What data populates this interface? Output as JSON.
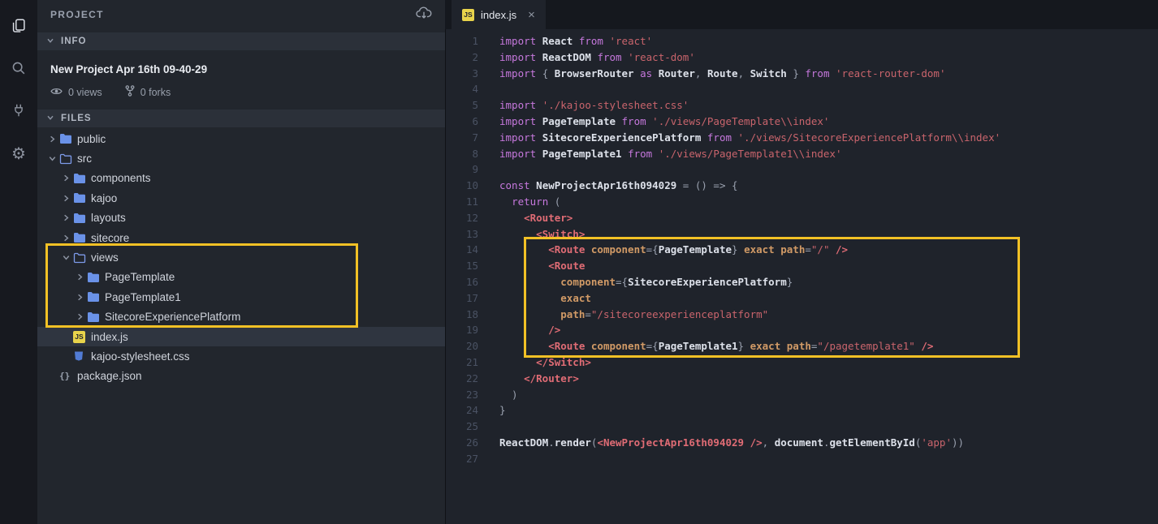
{
  "activity_bar": {
    "icons": [
      "files-icon",
      "search-icon",
      "plug-icon",
      "settings-icon"
    ]
  },
  "icons": {
    "js_badge": "JS",
    "json_badge": "{}",
    "close": "×",
    "settings": "⚙"
  },
  "sidebar": {
    "header": {
      "title": "PROJECT"
    },
    "info": {
      "label": "INFO",
      "project_name": "New Project Apr 16th 09-40-29",
      "views": "0 views",
      "forks": "0 forks"
    },
    "files": {
      "label": "FILES",
      "tree": [
        {
          "label": "public",
          "type": "folder",
          "state": "closed",
          "depth": 0
        },
        {
          "label": "src",
          "type": "folder",
          "state": "open",
          "depth": 0
        },
        {
          "label": "components",
          "type": "folder",
          "state": "closed",
          "depth": 1
        },
        {
          "label": "kajoo",
          "type": "folder",
          "state": "closed",
          "depth": 1
        },
        {
          "label": "layouts",
          "type": "folder",
          "state": "closed",
          "depth": 1
        },
        {
          "label": "sitecore",
          "type": "folder",
          "state": "closed",
          "depth": 1
        },
        {
          "label": "views",
          "type": "folder",
          "state": "open",
          "depth": 1
        },
        {
          "label": "PageTemplate",
          "type": "folder",
          "state": "closed",
          "depth": 2
        },
        {
          "label": "PageTemplate1",
          "type": "folder",
          "state": "closed",
          "depth": 2
        },
        {
          "label": "SitecoreExperiencePlatform",
          "type": "folder",
          "state": "closed",
          "depth": 2
        },
        {
          "label": "index.js",
          "type": "file",
          "icon": "js",
          "depth": 1,
          "selected": true
        },
        {
          "label": "kajoo-stylesheet.css",
          "type": "file",
          "icon": "css",
          "depth": 1
        },
        {
          "label": "package.json",
          "type": "file",
          "icon": "json",
          "depth": 0
        }
      ]
    }
  },
  "editor": {
    "tab": {
      "label": "index.js",
      "close_glyph": "×"
    },
    "code": {
      "palette": {
        "kw": "#c678dd",
        "id": "#dde1ea",
        "fn": "#dde1ea",
        "str": "#c9646c",
        "tag": "#e06c75",
        "attr": "#d19a66",
        "pun": "#9aa1af",
        "pl": "#abb2bf"
      },
      "lines": [
        [
          [
            "kw",
            "import"
          ],
          [
            "pl",
            " "
          ],
          [
            "id",
            "React"
          ],
          [
            "pl",
            " "
          ],
          [
            "kw",
            "from"
          ],
          [
            "pl",
            " "
          ],
          [
            "str",
            "'react'"
          ]
        ],
        [
          [
            "kw",
            "import"
          ],
          [
            "pl",
            " "
          ],
          [
            "id",
            "ReactDOM"
          ],
          [
            "pl",
            " "
          ],
          [
            "kw",
            "from"
          ],
          [
            "pl",
            " "
          ],
          [
            "str",
            "'react-dom'"
          ]
        ],
        [
          [
            "kw",
            "import"
          ],
          [
            "pl",
            " "
          ],
          [
            "pun",
            "{ "
          ],
          [
            "id",
            "BrowserRouter"
          ],
          [
            "pl",
            " "
          ],
          [
            "kw",
            "as"
          ],
          [
            "pl",
            " "
          ],
          [
            "id",
            "Router"
          ],
          [
            "pun",
            ", "
          ],
          [
            "id",
            "Route"
          ],
          [
            "pun",
            ", "
          ],
          [
            "id",
            "Switch"
          ],
          [
            "pun",
            " } "
          ],
          [
            "kw",
            "from"
          ],
          [
            "pl",
            " "
          ],
          [
            "str",
            "'react-router-dom'"
          ]
        ],
        [],
        [
          [
            "kw",
            "import"
          ],
          [
            "pl",
            " "
          ],
          [
            "str",
            "'./kajoo-stylesheet.css'"
          ]
        ],
        [
          [
            "kw",
            "import"
          ],
          [
            "pl",
            " "
          ],
          [
            "id",
            "PageTemplate"
          ],
          [
            "pl",
            " "
          ],
          [
            "kw",
            "from"
          ],
          [
            "pl",
            " "
          ],
          [
            "str",
            "'./views/PageTemplate\\\\index'"
          ]
        ],
        [
          [
            "kw",
            "import"
          ],
          [
            "pl",
            " "
          ],
          [
            "id",
            "SitecoreExperiencePlatform"
          ],
          [
            "pl",
            " "
          ],
          [
            "kw",
            "from"
          ],
          [
            "pl",
            " "
          ],
          [
            "str",
            "'./views/SitecoreExperiencePlatform\\\\index'"
          ]
        ],
        [
          [
            "kw",
            "import"
          ],
          [
            "pl",
            " "
          ],
          [
            "id",
            "PageTemplate1"
          ],
          [
            "pl",
            " "
          ],
          [
            "kw",
            "from"
          ],
          [
            "pl",
            " "
          ],
          [
            "str",
            "'./views/PageTemplate1\\\\index'"
          ]
        ],
        [],
        [
          [
            "kw",
            "const"
          ],
          [
            "pl",
            " "
          ],
          [
            "fn",
            "NewProjectApr16th094029"
          ],
          [
            "pun",
            " = () => {"
          ]
        ],
        [
          [
            "pl",
            "  "
          ],
          [
            "kw",
            "return"
          ],
          [
            "pun",
            " ("
          ]
        ],
        [
          [
            "pl",
            "    "
          ],
          [
            "tag",
            "<Router>"
          ]
        ],
        [
          [
            "pl",
            "      "
          ],
          [
            "tag",
            "<Switch>"
          ]
        ],
        [
          [
            "pl",
            "        "
          ],
          [
            "tag",
            "<Route"
          ],
          [
            "pl",
            " "
          ],
          [
            "attr",
            "component"
          ],
          [
            "pun",
            "={"
          ],
          [
            "id",
            "PageTemplate"
          ],
          [
            "pun",
            "}"
          ],
          [
            "pl",
            " "
          ],
          [
            "attr",
            "exact"
          ],
          [
            "pl",
            " "
          ],
          [
            "attr",
            "path"
          ],
          [
            "pun",
            "="
          ],
          [
            "str",
            "\"/\""
          ],
          [
            "pl",
            " "
          ],
          [
            "tag",
            "/>"
          ]
        ],
        [
          [
            "pl",
            "        "
          ],
          [
            "tag",
            "<Route"
          ]
        ],
        [
          [
            "pl",
            "          "
          ],
          [
            "attr",
            "component"
          ],
          [
            "pun",
            "={"
          ],
          [
            "id",
            "SitecoreExperiencePlatform"
          ],
          [
            "pun",
            "}"
          ]
        ],
        [
          [
            "pl",
            "          "
          ],
          [
            "attr",
            "exact"
          ]
        ],
        [
          [
            "pl",
            "          "
          ],
          [
            "attr",
            "path"
          ],
          [
            "pun",
            "="
          ],
          [
            "str",
            "\"/sitecoreexperienceplatform\""
          ]
        ],
        [
          [
            "pl",
            "        "
          ],
          [
            "tag",
            "/>"
          ]
        ],
        [
          [
            "pl",
            "        "
          ],
          [
            "tag",
            "<Route"
          ],
          [
            "pl",
            " "
          ],
          [
            "attr",
            "component"
          ],
          [
            "pun",
            "={"
          ],
          [
            "id",
            "PageTemplate1"
          ],
          [
            "pun",
            "}"
          ],
          [
            "pl",
            " "
          ],
          [
            "attr",
            "exact"
          ],
          [
            "pl",
            " "
          ],
          [
            "attr",
            "path"
          ],
          [
            "pun",
            "="
          ],
          [
            "str",
            "\"/pagetemplate1\""
          ],
          [
            "pl",
            " "
          ],
          [
            "tag",
            "/>"
          ]
        ],
        [
          [
            "pl",
            "      "
          ],
          [
            "tag",
            "</Switch>"
          ]
        ],
        [
          [
            "pl",
            "    "
          ],
          [
            "tag",
            "</Router>"
          ]
        ],
        [
          [
            "pun",
            "  )"
          ]
        ],
        [
          [
            "pun",
            "}"
          ]
        ],
        [],
        [
          [
            "id",
            "ReactDOM"
          ],
          [
            "pun",
            "."
          ],
          [
            "fn",
            "render"
          ],
          [
            "pun",
            "("
          ],
          [
            "tag",
            "<NewProjectApr16th094029"
          ],
          [
            "pl",
            " "
          ],
          [
            "tag",
            "/>"
          ],
          [
            "pun",
            ", "
          ],
          [
            "id",
            "document"
          ],
          [
            "pun",
            "."
          ],
          [
            "fn",
            "getElementById"
          ],
          [
            "pun",
            "("
          ],
          [
            "str",
            "'app'"
          ],
          [
            "pun",
            "))"
          ]
        ],
        []
      ]
    }
  },
  "annotations": {
    "color": "#f2c125",
    "boxes": [
      "views-folder-highlight",
      "routes-code-highlight"
    ]
  }
}
